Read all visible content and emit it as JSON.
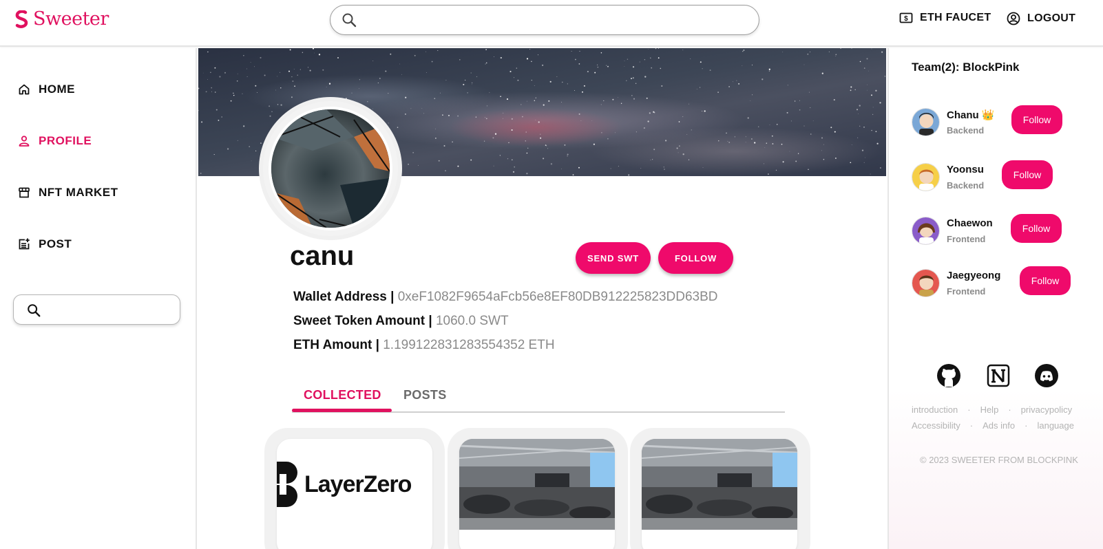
{
  "app": {
    "name": "Sweeter",
    "brand_color": "#e0115f",
    "button_color": "#ef0a6b"
  },
  "header": {
    "search_placeholder": "",
    "eth_faucet": "ETH FAUCET",
    "logout": "LOGOUT"
  },
  "sidebar": {
    "items": [
      {
        "label": "HOME",
        "icon": "home-icon",
        "active": false
      },
      {
        "label": "PROFILE",
        "icon": "person-icon",
        "active": true
      },
      {
        "label": "NFT MARKET",
        "icon": "store-icon",
        "active": false
      },
      {
        "label": "POST",
        "icon": "post-add-icon",
        "active": false
      }
    ],
    "search_placeholder": ""
  },
  "profile": {
    "username": "canu",
    "send_button": "SEND SWT",
    "follow_button": "FOLLOW",
    "wallet_label": "Wallet Address | ",
    "wallet_value": "0xeF1082F9654aFcb56e8EF80DB912225823DD63BD",
    "swt_label": "Sweet Token Amount | ",
    "swt_value": "1060.0 SWT",
    "eth_label": "ETH Amount | ",
    "eth_value": "1.199122831283554352 ETH"
  },
  "tabs": [
    {
      "label": "COLLECTED",
      "active": true
    },
    {
      "label": "POSTS",
      "active": false
    }
  ],
  "nft_cards": [
    {
      "image": "layerzero-logo",
      "logo_text": "LayerZero"
    },
    {
      "image": "conference-hall-photo"
    },
    {
      "image": "conference-hall-photo"
    }
  ],
  "team": {
    "title": "Team(2): BlockPink",
    "follow_label": "Follow",
    "members": [
      {
        "name": "Chanu 👑",
        "role": "Backend"
      },
      {
        "name": "Yoonsu",
        "role": "Backend"
      },
      {
        "name": "Chaewon",
        "role": "Frontend"
      },
      {
        "name": "Jaegyeong",
        "role": "Frontend"
      }
    ]
  },
  "social_icons": [
    "github-icon",
    "notion-icon",
    "discord-icon"
  ],
  "footer": {
    "links_row1": [
      "introduction",
      "Help",
      "privacypolicy"
    ],
    "links_row2": [
      "Accessibility",
      "Ads info",
      "language"
    ],
    "copyright": "© 2023 SWEETER FROM BLOCKPINK"
  }
}
